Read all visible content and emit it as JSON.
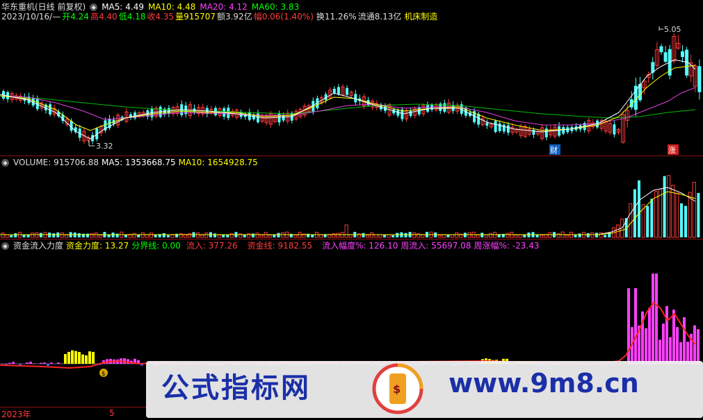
{
  "header": {
    "stock": "华东重机(日线 前复权)",
    "ma5": "MA5: 4.49",
    "ma10": "MA10: 4.48",
    "ma20": "MA20: 4.12",
    "ma60": "MA60: 3.83",
    "date": "2023/10/16/—",
    "open": "开4.24",
    "high": "高4.40",
    "low": "低4.18",
    "close": "收4.35",
    "volume": "量915707",
    "amount": "额3.92亿",
    "change": "幅0.06(1.40%)",
    "turnover": "换11.26%",
    "float": "流通8.13亿",
    "industry": "机床制造"
  },
  "price_panel": {
    "high_label": "5.05",
    "low_label": "3.32",
    "marker_cai": "财",
    "marker_zhang": "涨"
  },
  "volume_panel": {
    "title": "VOLUME: 915706.88",
    "ma5": "MA5: 1353668.75",
    "ma10": "MA10: 1654928.75"
  },
  "fund_panel": {
    "title": "资金流入力度",
    "force": "资金力度: 13.27",
    "boundary": "分界线: 0.00",
    "inflow": "流入: 377.26",
    "fund_line": "资金线: 9182.55",
    "inflow_pct": "流入幅度%: 126.10",
    "week_inflow": "周流入: 55697.08",
    "week_pct": "周涨幅%: -23.43"
  },
  "footer": {
    "year": "2023年",
    "month": "5"
  },
  "watermark": {
    "left": "公式指标网",
    "right": "www.9m8.cn"
  },
  "colors": {
    "up": "#ff3b3b",
    "down": "#54ffff",
    "ma5": "#ffffff",
    "ma10": "#ffff00",
    "ma20": "#ff40ff",
    "ma60": "#00ff00",
    "separator": "#8a1010"
  }
}
